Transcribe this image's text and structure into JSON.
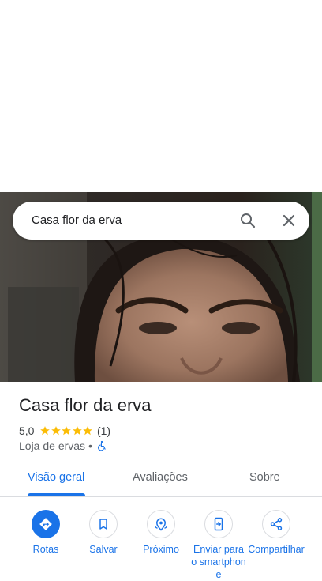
{
  "search": {
    "query": "Casa flor da erva"
  },
  "place": {
    "name": "Casa flor da erva",
    "rating": "5,0",
    "review_count": "(1)",
    "category": "Loja de ervas",
    "separator": "•"
  },
  "tabs": [
    {
      "label": "Visão geral",
      "active": true
    },
    {
      "label": "Avaliações",
      "active": false
    },
    {
      "label": "Sobre",
      "active": false
    }
  ],
  "actions": [
    {
      "label": "Rotas",
      "icon": "directions-icon"
    },
    {
      "label": "Salvar",
      "icon": "bookmark-icon"
    },
    {
      "label": "Próximo",
      "icon": "nearby-icon"
    },
    {
      "label": "Enviar para o smartphone",
      "icon": "send-to-phone-icon"
    },
    {
      "label": "Compartilhar",
      "icon": "share-icon"
    }
  ],
  "colors": {
    "accent": "#1a73e8",
    "star": "#fbbc04",
    "text": "#202124",
    "muted": "#5f6368"
  }
}
